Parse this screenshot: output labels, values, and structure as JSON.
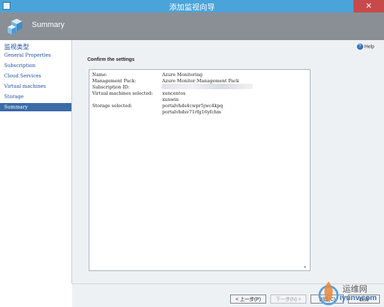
{
  "window": {
    "title": "添加监视向导",
    "close_label": "✕"
  },
  "banner": {
    "title": "Summary"
  },
  "sidebar": {
    "heading": "监视类型",
    "items": [
      {
        "label": "General Properties"
      },
      {
        "label": "Subscription"
      },
      {
        "label": "Cloud Services"
      },
      {
        "label": "Virtual machines"
      },
      {
        "label": "Storage"
      },
      {
        "label": "Summary",
        "active": true
      }
    ]
  },
  "main": {
    "help_label": "Help",
    "section_title": "Confirm the settings",
    "settings": [
      {
        "label": "Name:",
        "value": "Azure Monitoring"
      },
      {
        "label": "Management Pack:",
        "value": "Azure Monitor Management Pack"
      },
      {
        "label": "Subscription ID:",
        "value": ""
      },
      {
        "label": "Virtual machines selected:",
        "value": "xuncentos"
      },
      {
        "label": "",
        "value": "xunwin"
      },
      {
        "label": "Storage selected:",
        "value": "portalvhds4cwpr5jwc4kpq"
      },
      {
        "label": "",
        "value": "portalvhdsv71rfg16yfchm"
      }
    ],
    "colors": {
      "active_item": "#3a6aa8",
      "title_bar": "#4aa3d9",
      "banner": "#8a8f96"
    }
  },
  "footer": {
    "prev_label": "< 上一步(P)",
    "next_label": "下一步(N) >",
    "create_label": "创建(C)",
    "cancel_label": "取消"
  },
  "watermark": {
    "text_cn": "运维网",
    "text_url": "iyunv.com"
  }
}
